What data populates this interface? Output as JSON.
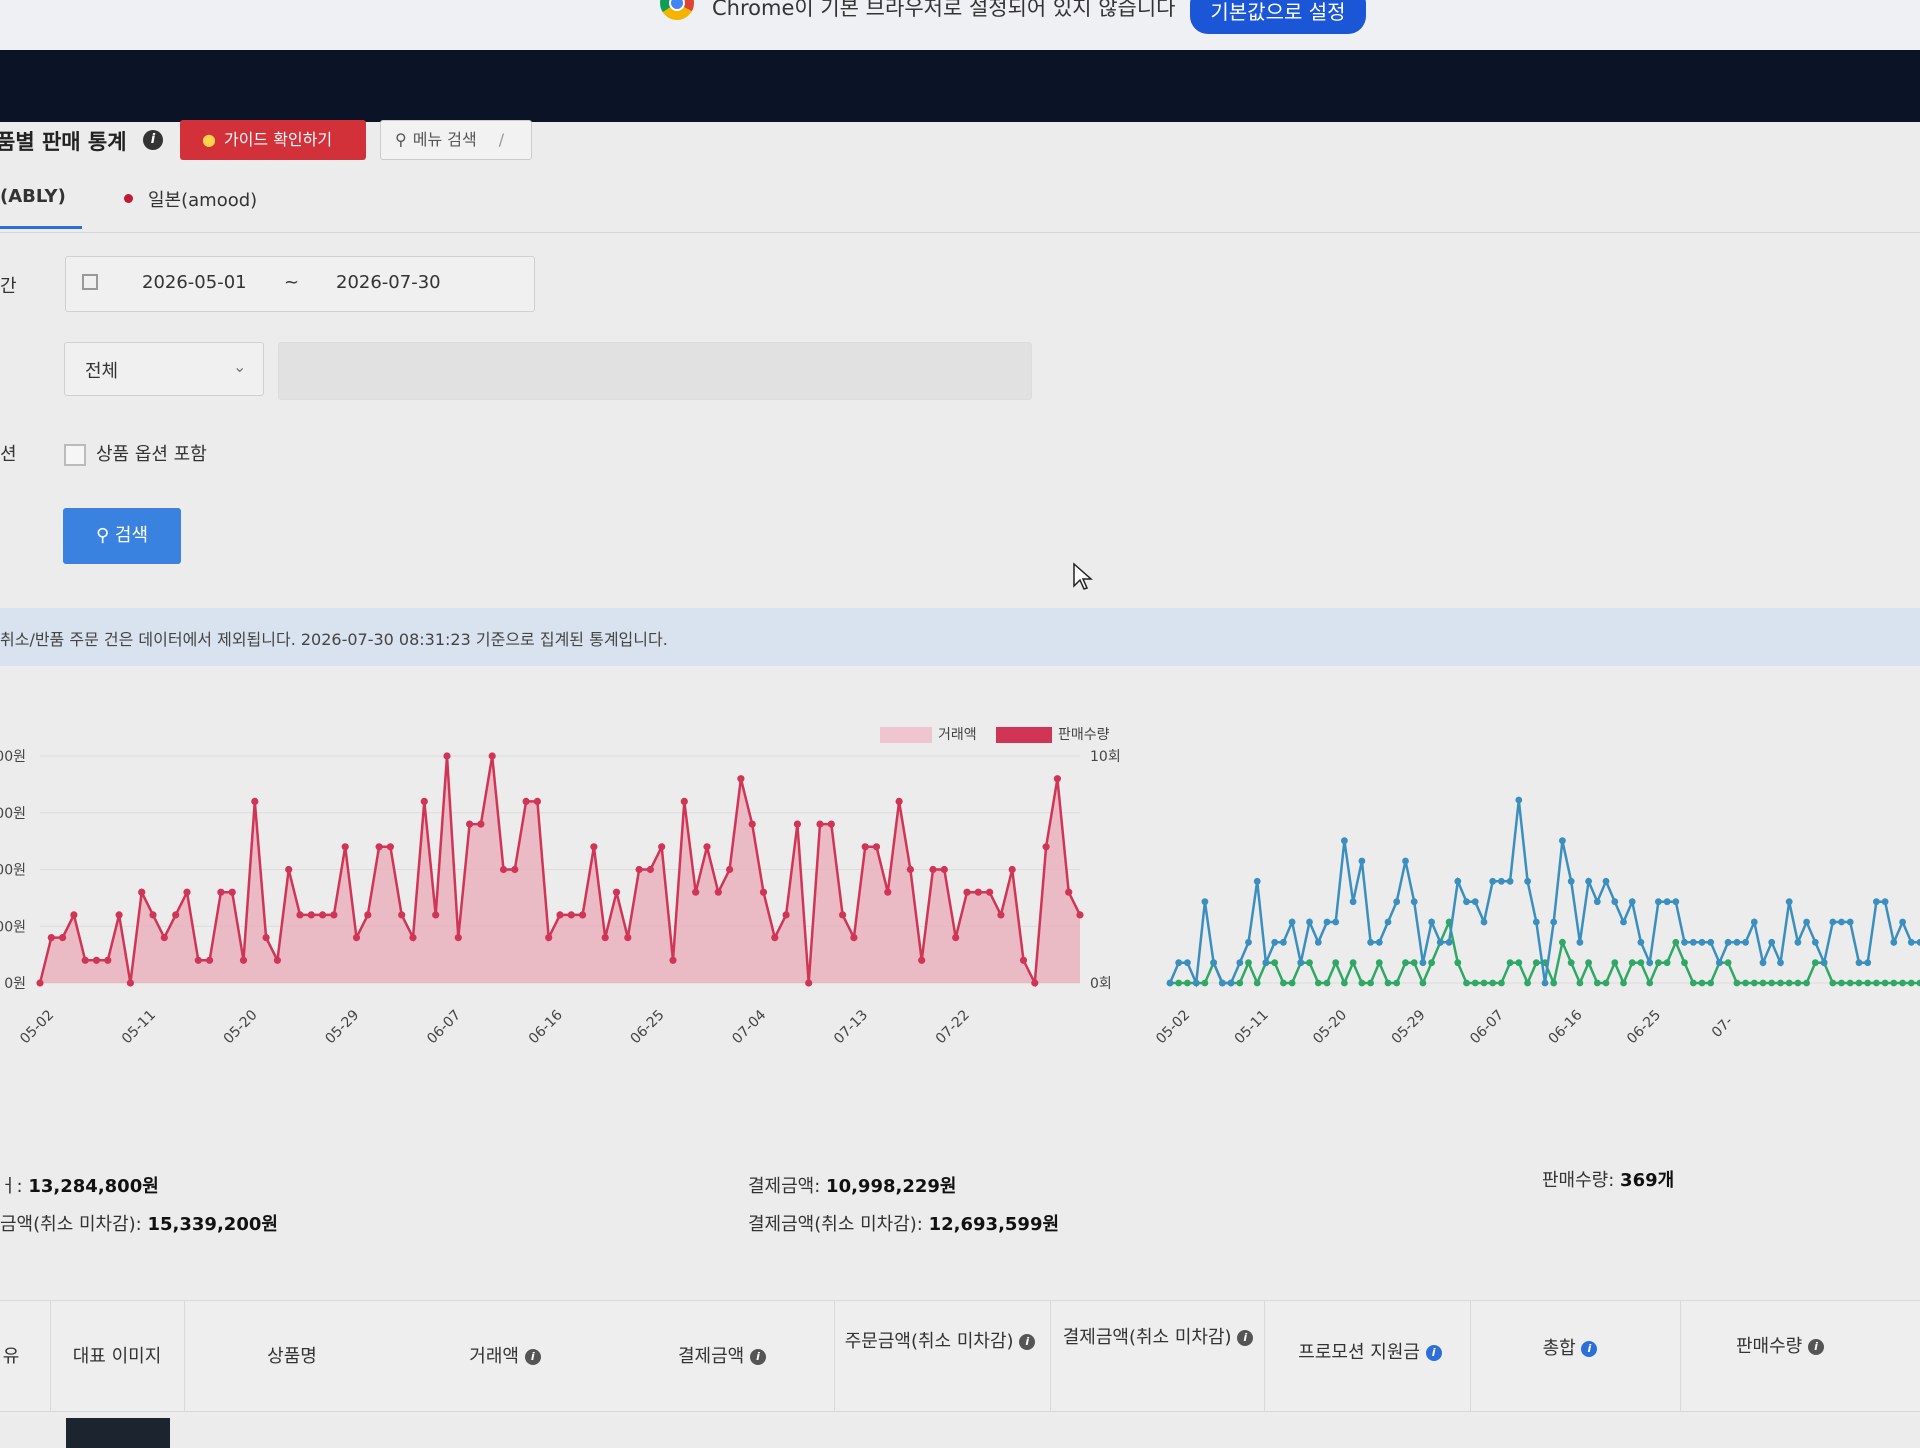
{
  "browser": {
    "default_message": "Chrome이 기본 브라우저로 설정되어 있지 않습니다",
    "set_default_button": "기본값으로 설정"
  },
  "header": {
    "title": "품별 판매 통계",
    "guide_button": "가이드 확인하기",
    "menu_search_label": "메뉴 검색",
    "menu_search_shortcut": "/"
  },
  "tabs": [
    {
      "label": "(ABLY)",
      "active": true
    },
    {
      "label": "일본(amood)",
      "active": false
    }
  ],
  "filters": {
    "period_label": "간",
    "date_start": "2026-05-01",
    "date_separator": "~",
    "date_end": "2026-07-30",
    "category_value": "전체",
    "keyword_placeholder": "",
    "option_label_side": "션",
    "option_checkbox_label": "상품 옵션 포함",
    "option_checked": false,
    "search_button": "검색"
  },
  "notice": "취소/반품 주문 건은 데이터에서 제외됩니다. 2026-07-30 08:31:23 기준으로 집계된 통계입니다.",
  "chart_data": [
    {
      "type": "line",
      "x_ticks": [
        "05-02",
        "05-11",
        "05-20",
        "05-29",
        "06-07",
        "06-16",
        "06-25",
        "07-04",
        "07-13",
        "07-22"
      ],
      "y_left_ticks": [
        "0원",
        "00원",
        "00원",
        "00원",
        "00원"
      ],
      "y_right_ticks": [
        "0회",
        "10회"
      ],
      "legend_position": "top-right",
      "series": [
        {
          "name": "거래액",
          "color": "#efc6cf",
          "values": []
        },
        {
          "name": "판매수량",
          "color": "#d03556",
          "axis": "right",
          "values": [
            0,
            2,
            2,
            3,
            1,
            1,
            1,
            3,
            0,
            4,
            3,
            2,
            3,
            4,
            1,
            1,
            4,
            4,
            1,
            8,
            2,
            1,
            5,
            3,
            3,
            3,
            3,
            6,
            2,
            3,
            6,
            6,
            3,
            2,
            8,
            3,
            10,
            2,
            7,
            7,
            10,
            5,
            5,
            8,
            8,
            2,
            3,
            3,
            3,
            6,
            2,
            4,
            2,
            5,
            5,
            6,
            1,
            8,
            4,
            6,
            4,
            5,
            9,
            7,
            4,
            2,
            3,
            7,
            0,
            7,
            7,
            3,
            2,
            6,
            6,
            4,
            8,
            5,
            1,
            5,
            5,
            2,
            4,
            4,
            4,
            3,
            5,
            1,
            0,
            6,
            9,
            4,
            3
          ]
        }
      ]
    },
    {
      "type": "line",
      "x_ticks": [
        "05-02",
        "05-11",
        "05-20",
        "05-29",
        "06-07",
        "06-16",
        "06-25",
        "07-"
      ],
      "series": [
        {
          "color": "#3a8fbf",
          "values": [
            0,
            1,
            1,
            0,
            4,
            1,
            0,
            0,
            1,
            2,
            5,
            1,
            2,
            2,
            3,
            1,
            3,
            2,
            3,
            3,
            7,
            4,
            6,
            2,
            2,
            3,
            4,
            6,
            4,
            1,
            3,
            2,
            2,
            5,
            4,
            4,
            3,
            5,
            5,
            5,
            9,
            5,
            3,
            0,
            3,
            7,
            5,
            2,
            5,
            4,
            5,
            4,
            3,
            4,
            2,
            1,
            4,
            4,
            4,
            2,
            2,
            2,
            2,
            1,
            2,
            2,
            2,
            3,
            1,
            2,
            1,
            4,
            2,
            3,
            2,
            1,
            3,
            3,
            3,
            1,
            1,
            4,
            4,
            2,
            3,
            2,
            2
          ]
        },
        {
          "color": "#2fa865",
          "values": [
            0,
            0,
            0,
            0,
            0,
            1,
            0,
            0,
            0,
            1,
            0,
            1,
            1,
            0,
            0,
            1,
            1,
            0,
            0,
            1,
            0,
            1,
            0,
            0,
            1,
            0,
            0,
            1,
            1,
            0,
            1,
            2,
            3,
            1,
            0,
            0,
            0,
            0,
            0,
            1,
            1,
            0,
            1,
            1,
            0,
            2,
            1,
            0,
            1,
            0,
            0,
            1,
            0,
            1,
            1,
            0,
            1,
            1,
            2,
            1,
            0,
            0,
            0,
            1,
            1,
            0,
            0,
            0,
            0,
            0,
            0,
            0,
            0,
            0,
            1,
            1,
            0,
            0,
            0,
            0,
            0,
            0,
            0,
            0,
            0,
            0,
            0
          ]
        }
      ]
    }
  ],
  "summary": {
    "transaction_label": "ㅓ:",
    "transaction_value": "13,284,800원",
    "order_cancel_label": "금액(취소 미차감):",
    "order_cancel_value": "15,339,200원",
    "payment_label": "결제금액:",
    "payment_value": "10,998,229원",
    "payment_cancel_label": "결제금액(취소 미차감):",
    "payment_cancel_value": "12,693,599원",
    "quantity_label": "판매수량:",
    "quantity_value": "369개"
  },
  "table": {
    "columns": [
      {
        "label": "유",
        "info": false
      },
      {
        "label": "대표 이미지",
        "info": false
      },
      {
        "label": "상품명",
        "info": false
      },
      {
        "label": "거래액",
        "info": true
      },
      {
        "label": "결제금액",
        "info": true
      },
      {
        "label": "주문금액(취소 미차감)",
        "info": true
      },
      {
        "label": "결제금액(취소 미차감)",
        "info": true
      },
      {
        "label": "프로모션 지원금",
        "info": true
      },
      {
        "label": "총합",
        "info": true
      },
      {
        "label": "판매수량",
        "info": true
      }
    ]
  }
}
